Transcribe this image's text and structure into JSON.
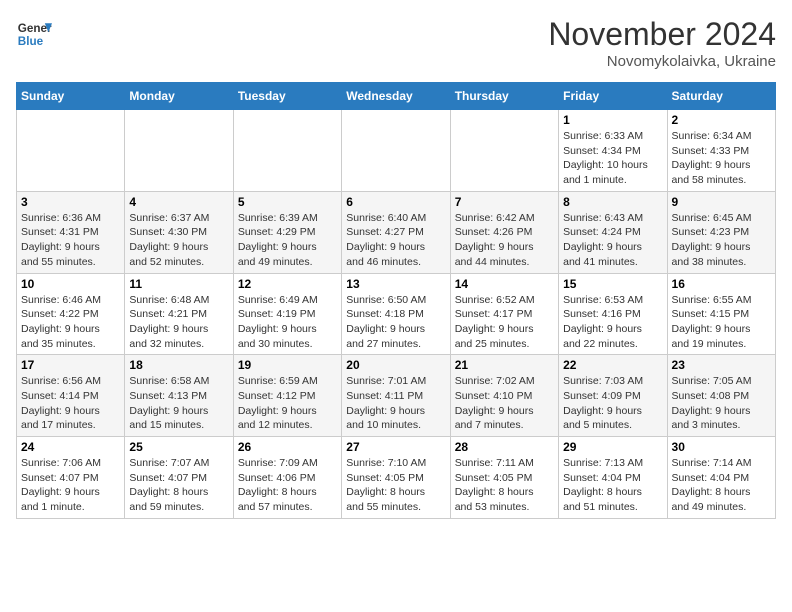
{
  "header": {
    "logo_line1": "General",
    "logo_line2": "Blue",
    "month_title": "November 2024",
    "subtitle": "Novomykolaivka, Ukraine"
  },
  "weekdays": [
    "Sunday",
    "Monday",
    "Tuesday",
    "Wednesday",
    "Thursday",
    "Friday",
    "Saturday"
  ],
  "weeks": [
    [
      {
        "day": "",
        "info": ""
      },
      {
        "day": "",
        "info": ""
      },
      {
        "day": "",
        "info": ""
      },
      {
        "day": "",
        "info": ""
      },
      {
        "day": "",
        "info": ""
      },
      {
        "day": "1",
        "info": "Sunrise: 6:33 AM\nSunset: 4:34 PM\nDaylight: 10 hours\nand 1 minute."
      },
      {
        "day": "2",
        "info": "Sunrise: 6:34 AM\nSunset: 4:33 PM\nDaylight: 9 hours\nand 58 minutes."
      }
    ],
    [
      {
        "day": "3",
        "info": "Sunrise: 6:36 AM\nSunset: 4:31 PM\nDaylight: 9 hours\nand 55 minutes."
      },
      {
        "day": "4",
        "info": "Sunrise: 6:37 AM\nSunset: 4:30 PM\nDaylight: 9 hours\nand 52 minutes."
      },
      {
        "day": "5",
        "info": "Sunrise: 6:39 AM\nSunset: 4:29 PM\nDaylight: 9 hours\nand 49 minutes."
      },
      {
        "day": "6",
        "info": "Sunrise: 6:40 AM\nSunset: 4:27 PM\nDaylight: 9 hours\nand 46 minutes."
      },
      {
        "day": "7",
        "info": "Sunrise: 6:42 AM\nSunset: 4:26 PM\nDaylight: 9 hours\nand 44 minutes."
      },
      {
        "day": "8",
        "info": "Sunrise: 6:43 AM\nSunset: 4:24 PM\nDaylight: 9 hours\nand 41 minutes."
      },
      {
        "day": "9",
        "info": "Sunrise: 6:45 AM\nSunset: 4:23 PM\nDaylight: 9 hours\nand 38 minutes."
      }
    ],
    [
      {
        "day": "10",
        "info": "Sunrise: 6:46 AM\nSunset: 4:22 PM\nDaylight: 9 hours\nand 35 minutes."
      },
      {
        "day": "11",
        "info": "Sunrise: 6:48 AM\nSunset: 4:21 PM\nDaylight: 9 hours\nand 32 minutes."
      },
      {
        "day": "12",
        "info": "Sunrise: 6:49 AM\nSunset: 4:19 PM\nDaylight: 9 hours\nand 30 minutes."
      },
      {
        "day": "13",
        "info": "Sunrise: 6:50 AM\nSunset: 4:18 PM\nDaylight: 9 hours\nand 27 minutes."
      },
      {
        "day": "14",
        "info": "Sunrise: 6:52 AM\nSunset: 4:17 PM\nDaylight: 9 hours\nand 25 minutes."
      },
      {
        "day": "15",
        "info": "Sunrise: 6:53 AM\nSunset: 4:16 PM\nDaylight: 9 hours\nand 22 minutes."
      },
      {
        "day": "16",
        "info": "Sunrise: 6:55 AM\nSunset: 4:15 PM\nDaylight: 9 hours\nand 19 minutes."
      }
    ],
    [
      {
        "day": "17",
        "info": "Sunrise: 6:56 AM\nSunset: 4:14 PM\nDaylight: 9 hours\nand 17 minutes."
      },
      {
        "day": "18",
        "info": "Sunrise: 6:58 AM\nSunset: 4:13 PM\nDaylight: 9 hours\nand 15 minutes."
      },
      {
        "day": "19",
        "info": "Sunrise: 6:59 AM\nSunset: 4:12 PM\nDaylight: 9 hours\nand 12 minutes."
      },
      {
        "day": "20",
        "info": "Sunrise: 7:01 AM\nSunset: 4:11 PM\nDaylight: 9 hours\nand 10 minutes."
      },
      {
        "day": "21",
        "info": "Sunrise: 7:02 AM\nSunset: 4:10 PM\nDaylight: 9 hours\nand 7 minutes."
      },
      {
        "day": "22",
        "info": "Sunrise: 7:03 AM\nSunset: 4:09 PM\nDaylight: 9 hours\nand 5 minutes."
      },
      {
        "day": "23",
        "info": "Sunrise: 7:05 AM\nSunset: 4:08 PM\nDaylight: 9 hours\nand 3 minutes."
      }
    ],
    [
      {
        "day": "24",
        "info": "Sunrise: 7:06 AM\nSunset: 4:07 PM\nDaylight: 9 hours\nand 1 minute."
      },
      {
        "day": "25",
        "info": "Sunrise: 7:07 AM\nSunset: 4:07 PM\nDaylight: 8 hours\nand 59 minutes."
      },
      {
        "day": "26",
        "info": "Sunrise: 7:09 AM\nSunset: 4:06 PM\nDaylight: 8 hours\nand 57 minutes."
      },
      {
        "day": "27",
        "info": "Sunrise: 7:10 AM\nSunset: 4:05 PM\nDaylight: 8 hours\nand 55 minutes."
      },
      {
        "day": "28",
        "info": "Sunrise: 7:11 AM\nSunset: 4:05 PM\nDaylight: 8 hours\nand 53 minutes."
      },
      {
        "day": "29",
        "info": "Sunrise: 7:13 AM\nSunset: 4:04 PM\nDaylight: 8 hours\nand 51 minutes."
      },
      {
        "day": "30",
        "info": "Sunrise: 7:14 AM\nSunset: 4:04 PM\nDaylight: 8 hours\nand 49 minutes."
      }
    ]
  ]
}
